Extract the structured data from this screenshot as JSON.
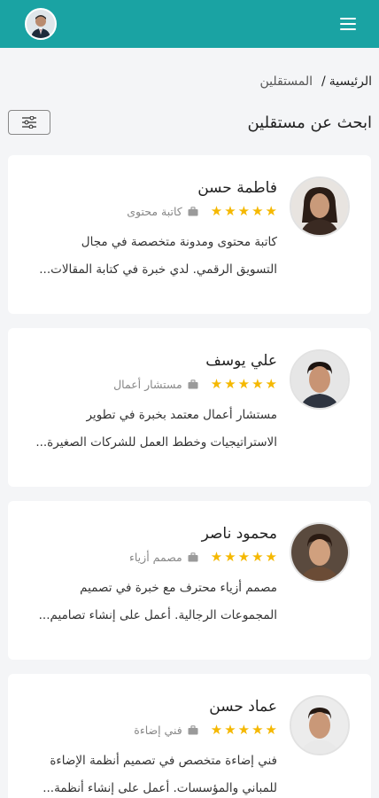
{
  "header": {
    "menu_icon": "hamburger-icon",
    "avatar_icon": "user-avatar"
  },
  "breadcrumb": {
    "home": "الرئيسية",
    "separator": "/",
    "current": "المستقلين"
  },
  "search": {
    "title": "ابحث عن مستقلين",
    "filter_icon": "sliders-icon"
  },
  "freelancers": [
    {
      "name": "فاطمة حسن",
      "job": "كاتبة محتوى",
      "rating": 5,
      "desc_line1": "كاتبة محتوى ومدونة متخصصة في مجال",
      "desc_line2": "التسويق الرقمي. لدي خبرة في كتابة المقالات..."
    },
    {
      "name": "علي يوسف",
      "job": "مستشار أعمال",
      "rating": 5,
      "desc_line1": "مستشار أعمال معتمد بخبرة في تطوير",
      "desc_line2": "الاستراتيجيات وخطط العمل للشركات الصغيرة..."
    },
    {
      "name": "محمود ناصر",
      "job": "مصمم أزياء",
      "rating": 5,
      "desc_line1": "مصمم أزياء محترف مع خبرة في تصميم",
      "desc_line2": "المجموعات الرجالية. أعمل على إنشاء تصاميم..."
    },
    {
      "name": "عماد حسن",
      "job": "فني إضاءة",
      "rating": 5,
      "desc_line1": "فني إضاءة متخصص في تصميم أنظمة الإضاءة",
      "desc_line2": "للمباني والمؤسسات. أعمل على إنشاء أنظمة..."
    }
  ]
}
